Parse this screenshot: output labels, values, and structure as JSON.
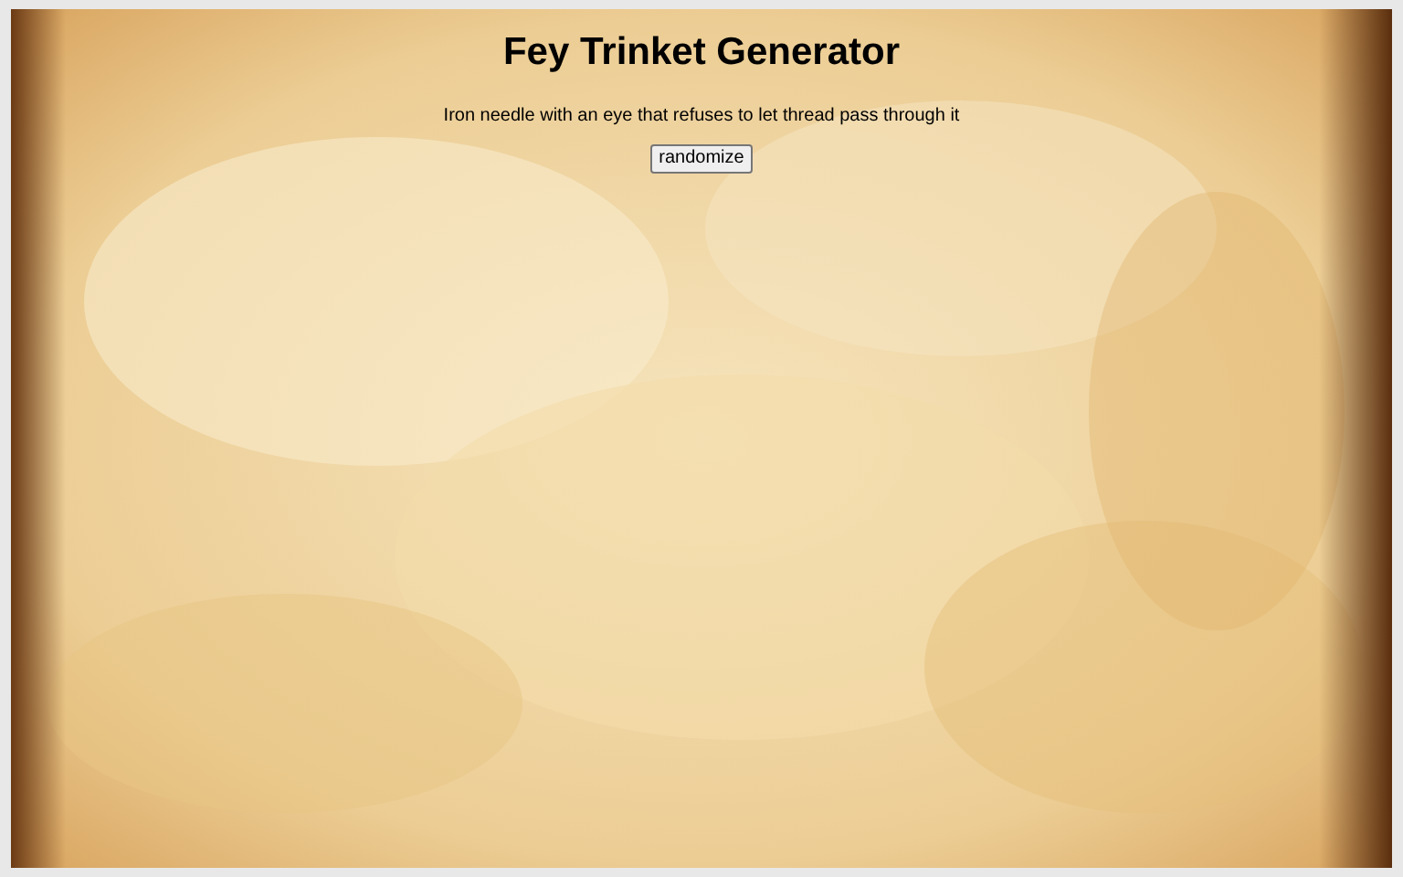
{
  "title": "Fey Trinket Generator",
  "trinket": "Iron needle with an eye that refuses to let thread pass through it",
  "button": "randomize"
}
